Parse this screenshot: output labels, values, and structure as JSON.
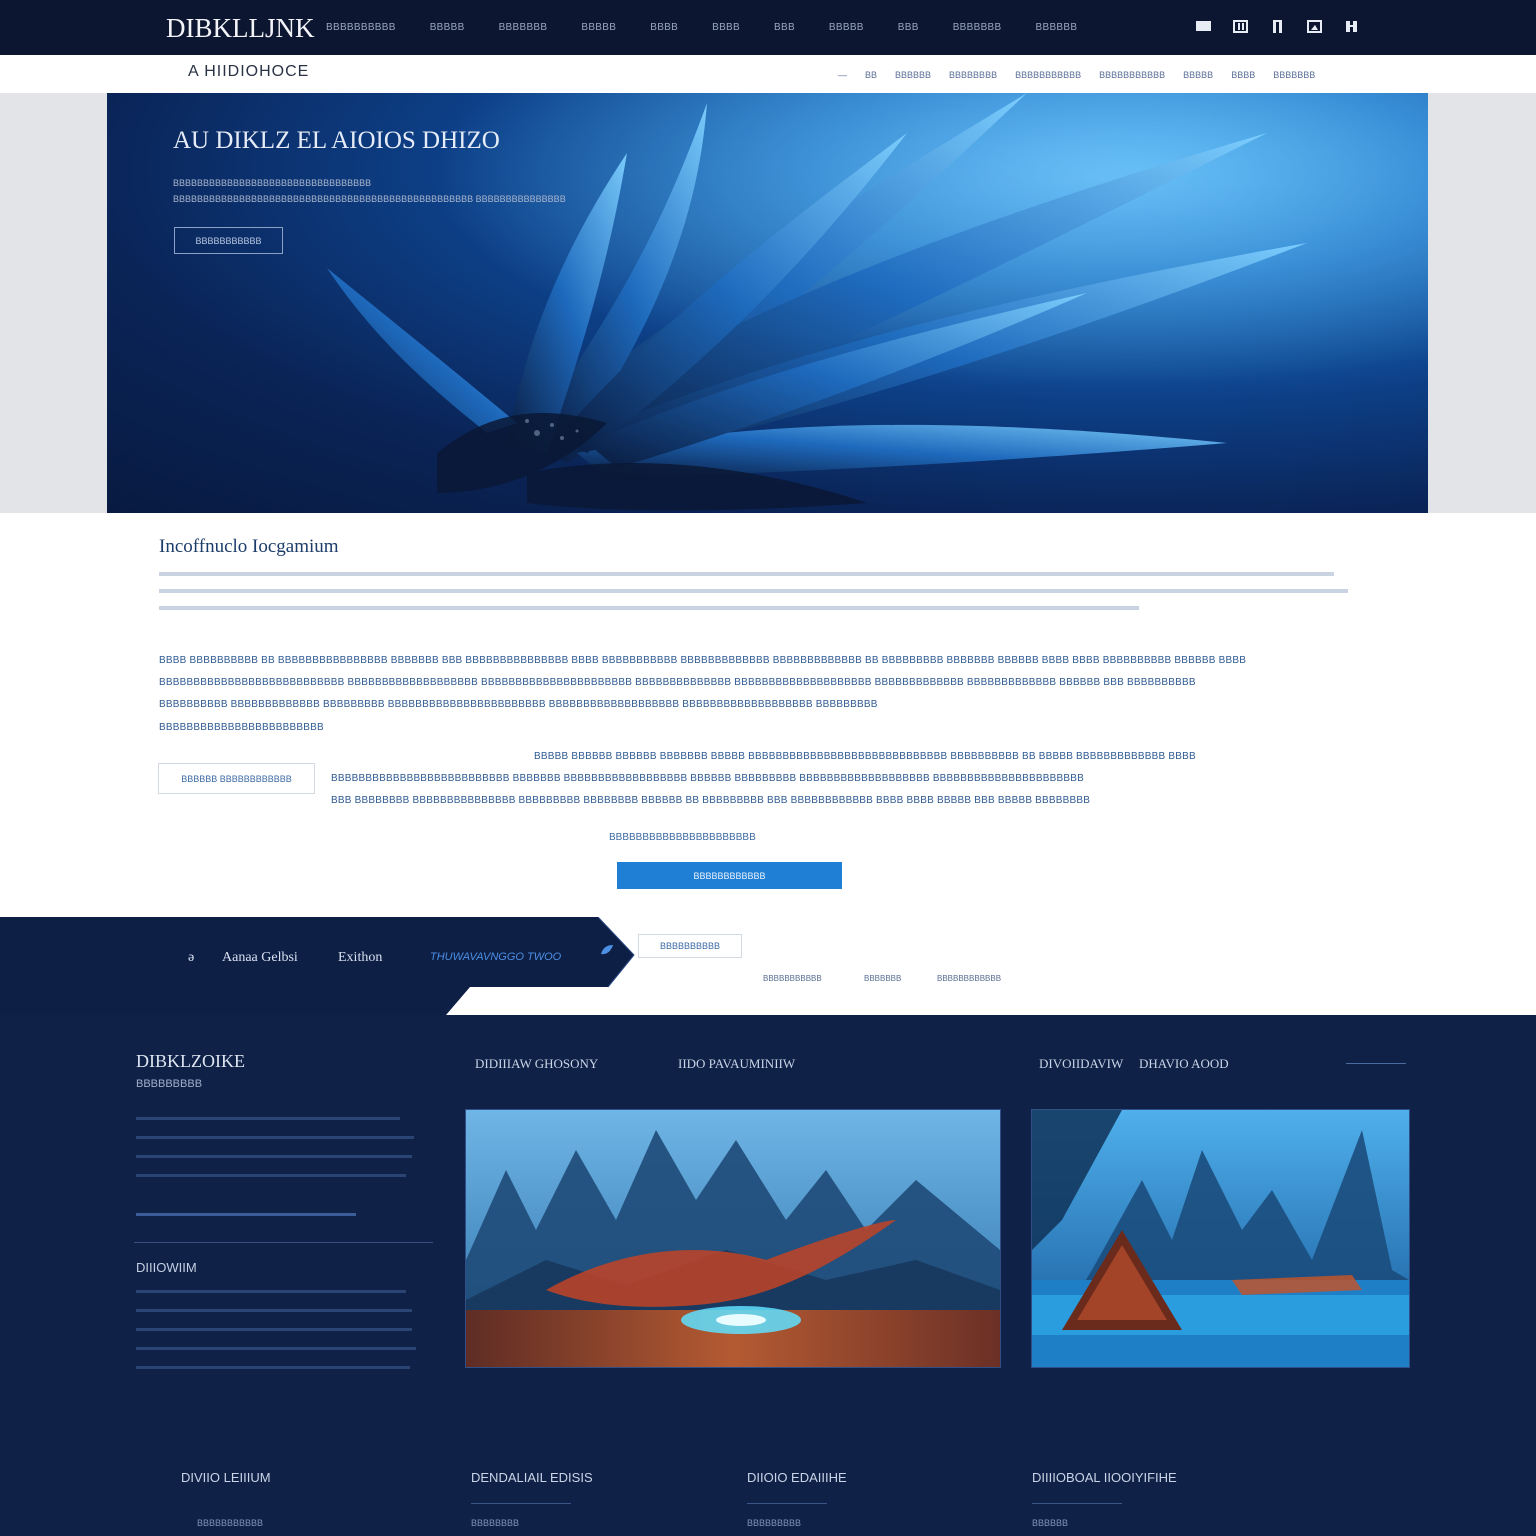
{
  "nav": {
    "brand": "DIBKLLJNK",
    "links": [
      "ВВВВВВВВВВ",
      "ВВВВВ",
      "ВВВВВВВ",
      "ВВВВВ",
      "ВВВВ",
      "ВВВВ",
      "ВВВ",
      "ВВВВВ",
      "ВВВ",
      "ВВВВВВВ",
      "ВВВВВВ"
    ],
    "icons": [
      "menu-icon",
      "grid-icon",
      "bookmark-icon",
      "image-icon",
      "user-icon"
    ]
  },
  "subbar": {
    "title": "A HIIDIOHOCE",
    "links": [
      "—",
      "ВВ",
      "ВВВВВВ",
      "ВВВВВВВВ",
      "ВВВВВВВВВВВ",
      "ВВВВВВВВВВВ",
      "ВВВВВ",
      "ВВВВ",
      "ВВВВВВВ"
    ]
  },
  "hero": {
    "title": "AU DIKLZ EL AIOIOS DHIZO",
    "line1": "ВВВВВВВВВВВВВВВВВВВВВВВВВВВВВВВВВ",
    "line2": "ВВВВВВВВВВВВВВВВВВВВВВВВВВВВВВВВВВВВВВВВВВВВВВВВВВ  ВВВВВВВВВВВВВВВ",
    "button": "ВВВВВВВВВВВ"
  },
  "content": {
    "title": "Incoffnuclo Iocgamium",
    "para1": "ВВВВ ВВВВВВВВВВ ВВ ВВВВВВВВВВВВВВВВ ВВВВВВВ ВВВ ВВВВВВВВВВВВВВВ ВВВВ ВВВВВВВВВВВ ВВВВВВВВВВВВВ ВВВВВВВВВВВВВ ВВ ВВВВВВВВВ ВВВВВВВ ВВВВВВ ВВВВ ВВВВ ВВВВВВВВВВ ВВВВВВ ВВВВ",
    "para2": "ВВВВВВВВВВВВВВВВВВВВВВВВВВВ ВВВВВВВВВВВВВВВВВВВ ВВВВВВВВВВВВВВВВВВВВВВ ВВВВВВВВВВВВВВ ВВВВВВВВВВВВВВВВВВВВ ВВВВВВВВВВВВВ ВВВВВВВВВВВВВ ВВВВВВ ВВВ ВВВВВВВВВВ",
    "para3": "ВВВВВВВВВВ ВВВВВВВВВВВВВ ВВВВВВВВВ ВВВВВВВВВВВВВВВВВВВВВВВ ВВВВВВВВВВВВВВВВВВВ ВВВВВВВВВВВВВВВВВВВ ВВВВВВВВВ",
    "para4": "ВВВВВВВВВВВВВВВВВВВВВВВВ",
    "button_outline": "ВВВВВВ ВВВВВВВВВВВВ",
    "para5": "ВВВВВ ВВВВВВ ВВВВВВ ВВВВВВВ ВВВВВ ВВВВВВВВВВВВВВВВВВВВВВВВВВВВВ ВВВВВВВВВВ ВВ ВВВВВ ВВВВВВВВВВВВВ ВВВВ",
    "para6": "ВВВВВВВВВВВВВВВВВВВВВВВВВВ ВВВВВВВ ВВВВВВВВВВВВВВВВВВ ВВВВВВ ВВВВВВВВВ ВВВВВВВВВВВВВВВВВВВ ВВВВВВВВВВВВВВВВВВВВВВ",
    "para7": "ВВВ ВВВВВВВВ ВВВВВВВВВВВВВВВ ВВВВВВВВВ ВВВВВВВВ ВВВВВВ ВВ ВВВВВВВВВ ВВВ ВВВВВВВВВВВВ ВВВВ ВВВВ ВВВВВ ВВВ ВВВВВ ВВВВВВВВ",
    "caption": "ВВВВВВВВВВВВВВВВВВВВВВ",
    "button_primary": "ВВВВВВВВВВВВ"
  },
  "band": {
    "tab_marker": "ǝ",
    "tab1": "Aanaa Gelbsi",
    "tab2": "Exithon",
    "tab_active": "THUWAVAVNGGO TWOO",
    "tag": "ВВВВВВВВВВ",
    "mini_links": [
      "ВВВВВВВВВВВ",
      "ВВВВВВВ",
      "ВВВВВВВВВВВВ"
    ]
  },
  "sidebar": {
    "title": "DIBKLZOIKE",
    "subtitle": "ВВВВВВВВВ",
    "heading2": "DIIIOWIIM"
  },
  "columns": {
    "heads": [
      "DIDIIIAW GHOSONY",
      "IIDO PAVAUMINIIW",
      "DIVOIIDAVIW",
      "DHAVIO AOOD"
    ]
  },
  "footer": {
    "heads": [
      "DIVIIO LEIIIUM",
      "DENDALIAIL EDISIS",
      "DIIOIO EDAIIIHE",
      "DIIIIOBOAL IIOOIYIFIHE"
    ],
    "subs": [
      "ВВВВВВВВВВВ",
      "ВВВВВВВВ",
      "ВВВВВВВВВ",
      "ВВВВВВ"
    ]
  },
  "colors": {
    "nav_bg": "#0c1630",
    "dark_section": "#0f2147",
    "accent": "#1f7fd4",
    "body_text": "#2f5a92"
  }
}
